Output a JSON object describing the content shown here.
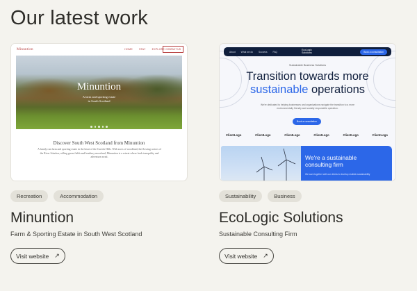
{
  "page": {
    "title": "Our latest work"
  },
  "projects": [
    {
      "title": "Minuntion",
      "subtitle": "Farm & Sporting Estate in South West Scotland",
      "tags": [
        "Recreation",
        "Accommodation"
      ],
      "visit_label": "Visit website",
      "thumbnail": {
        "logo": "Minuntion",
        "nav": [
          "HOME",
          "STAY",
          "EXPLORE"
        ],
        "contact": "CONTACT US",
        "hero_title": "Minuntion",
        "hero_sub_1": "A farm and sporting estate",
        "hero_sub_2": "in South Scotland",
        "discover": "Discover South West Scotland from Minuntion",
        "body": "A family run farm and sporting estate in the heart of the Carrick Hills. With acres of woodland, the flowing waters of the River Stinchar, rolling green fields and heathery moorland, Minuntion is a retreat where fresh tranquility and adventure await."
      }
    },
    {
      "title": "EcoLogic Solutions",
      "subtitle": "Sustainable Consulting Firm",
      "tags": [
        "Sustainability",
        "Business"
      ],
      "visit_label": "Visit website",
      "thumbnail": {
        "nav": [
          "About",
          "What we do",
          "Success",
          "FAQ"
        ],
        "logo_1": "EcoLogic",
        "logo_2": "Solutions",
        "cta": "Book a consultation",
        "eyebrow": "Sustainable Business Solutions",
        "h1_line1": "Transition towards more",
        "h1_blue": "sustainable",
        "h1_rest": " operations",
        "lead": "We're dedicated to helping businesses and organisations navigate the transition to a more environmentally friendly and socially responsible operation.",
        "button": "Book a consultation",
        "clients": [
          "ClientLogo",
          "ClientLogo",
          "ClientLogo",
          "ClientLogo",
          "ClientLogo",
          "ClientLogo"
        ],
        "panel_title_1": "We're a sustainable",
        "panel_title_2": "consulting firm",
        "panel_text": "We work together with our clients to develop realistic sustainability"
      }
    }
  ],
  "colors": {
    "background": "#f4f3ee",
    "tag_bg": "#e3e1d9",
    "eco_blue": "#2c67e8",
    "eco_navy": "#0f1e3c",
    "minuntion_red": "#b43838"
  },
  "icons": {
    "visit": "arrow-up-right-icon"
  }
}
